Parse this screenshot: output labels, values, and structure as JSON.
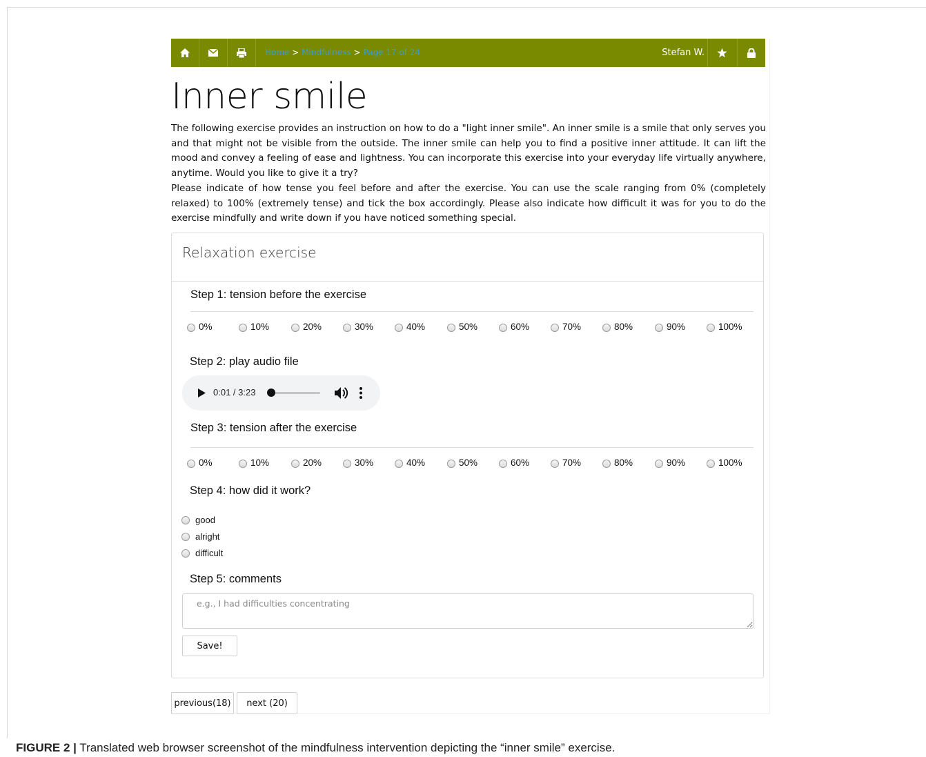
{
  "navbar": {
    "breadcrumb": {
      "home": "Home",
      "sep1": " > ",
      "section": "Mindfulness",
      "sep2": " > ",
      "page": "Page 17 of 24"
    },
    "user": "Stefan W.",
    "icons": [
      "home-icon",
      "envelope-icon",
      "print-icon",
      "star-icon",
      "lock-icon"
    ],
    "bar_color": "#7a8a00"
  },
  "title": "Inner smile",
  "paragraphs": [
    "The following exercise provides an instruction on how to do a \"light inner smile\". An inner smile is a smile that only serves you and that might not be visible from the outside. The inner smile can help you to find a positive inner attitude. It can lift the mood and convey a feeling of ease and lightness. You can incorporate this exercise into your everyday life virtually anywhere, anytime. Would you like to give it a try?",
    "Please indicate of how tense you feel before and after the exercise. You can use the scale ranging from 0% (completely relaxed) to 100% (extremely tense) and tick the box accordingly. Please also indicate how difficult it was for you to do the exercise mindfully and write down if you have noticed something special."
  ],
  "panel": {
    "title": "Relaxation exercise",
    "step1": {
      "label": "Step 1: tension before the exercise"
    },
    "step2": {
      "label": "Step 2: play audio file"
    },
    "step3": {
      "label": "Step 3: tension after the exercise"
    },
    "step4": {
      "label": "Step 4: how did it work?"
    },
    "step5": {
      "label": "Step 5: comments"
    },
    "scale": [
      "0%",
      "10%",
      "20%",
      "30%",
      "40%",
      "50%",
      "60%",
      "70%",
      "80%",
      "90%",
      "100%"
    ],
    "audio": {
      "time": "0:01 / 3:23",
      "progress": 0.005
    },
    "work_options": [
      "good",
      "alright",
      "difficult"
    ],
    "comments_placeholder": "e.g., I had difficulties concentrating",
    "save_label": "Save!"
  },
  "pager": {
    "previous": "previous(18)",
    "next": "next (20)"
  },
  "caption": {
    "label": "FIGURE 2 |",
    "text": " Translated web browser screenshot of the mindfulness intervention depicting the “inner smile” exercise."
  }
}
